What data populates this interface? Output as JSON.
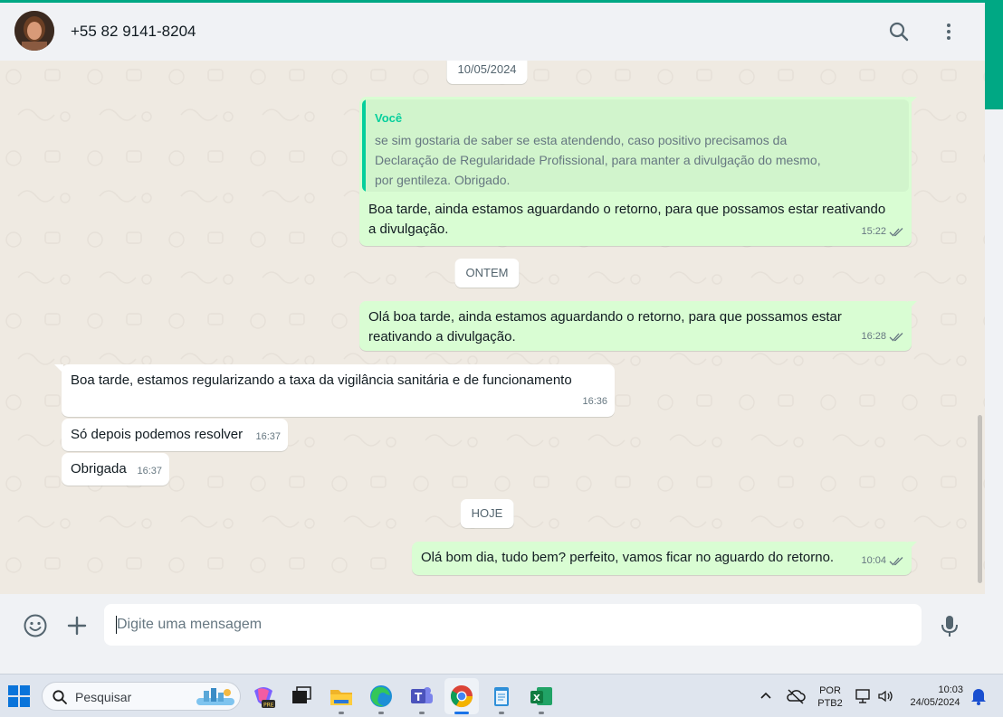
{
  "header": {
    "contact_name": "+55 82 9141-8204"
  },
  "chat": {
    "date_chips": [
      "10/05/2024",
      "ONTEM",
      "HOJE"
    ],
    "messages": [
      {
        "direction": "out",
        "quote_author": "Você",
        "quote_lines": [
          "se sim gostaria de saber se esta atendendo, caso positivo precisamos da",
          "Declaração de Regularidade Profissional, para manter a divulgação do mesmo,",
          "por gentileza. Obrigado."
        ],
        "lines": [
          "Boa tarde, ainda estamos aguardando o retorno, para que possamos estar reativando",
          "a divulgação."
        ],
        "time": "15:22",
        "status": "read"
      },
      {
        "direction": "out",
        "lines": [
          "Olá boa tarde, ainda estamos aguardando o retorno, para que possamos estar",
          "reativando a divulgação."
        ],
        "time": "16:28",
        "status": "read"
      },
      {
        "direction": "in",
        "lines": [
          "Boa tarde, estamos regularizando a taxa da vigilância sanitária e de funcionamento"
        ],
        "time": "16:36"
      },
      {
        "direction": "in",
        "lines": [
          "Só depois podemos resolver"
        ],
        "time": "16:37"
      },
      {
        "direction": "in",
        "lines": [
          "Obrigada"
        ],
        "time": "16:37"
      },
      {
        "direction": "out",
        "lines": [
          "Olá bom dia, tudo bem? perfeito, vamos ficar no aguardo do retorno."
        ],
        "time": "10:04",
        "status": "read"
      }
    ]
  },
  "composer": {
    "placeholder": "Digite uma mensagem"
  },
  "taskbar": {
    "search_label": "Pesquisar",
    "language_line1": "POR",
    "language_line2": "PTB2",
    "time": "10:03",
    "date": "24/05/2024"
  },
  "colors": {
    "accent": "#00a884",
    "outgoing_bubble": "#d9fdd3",
    "incoming_bubble": "#ffffff",
    "chat_background": "#efeae2",
    "read_ticks": "#667781"
  }
}
